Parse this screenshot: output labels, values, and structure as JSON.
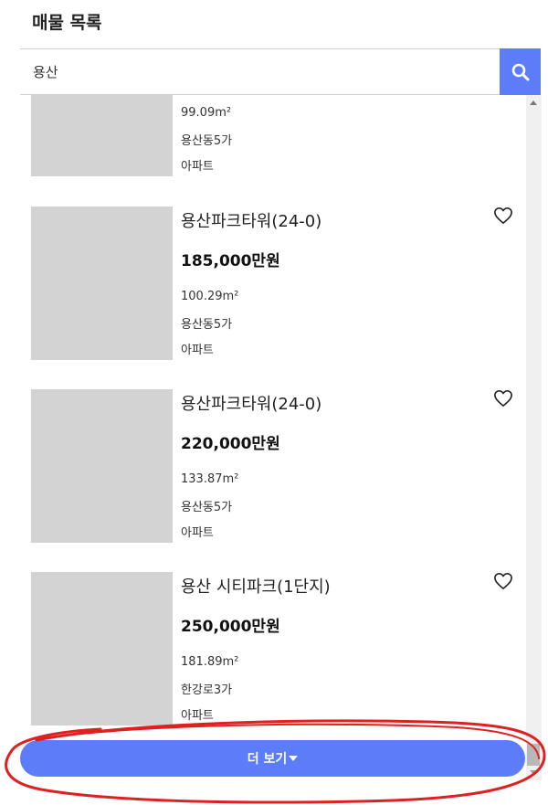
{
  "header": {
    "title": "매물 목록"
  },
  "search": {
    "value": "용산",
    "button_icon": "search-icon"
  },
  "partial_item": {
    "area": "99.09m²",
    "address": "용산동5가",
    "type": "아파트"
  },
  "listings": [
    {
      "name": "용산파크타워(24-0)",
      "price": "185,000만원",
      "area": "100.29m²",
      "address": "용산동5가",
      "type": "아파트"
    },
    {
      "name": "용산파크타워(24-0)",
      "price": "220,000만원",
      "area": "133.87m²",
      "address": "용산동5가",
      "type": "아파트"
    },
    {
      "name": "용산 시티파크(1단지)",
      "price": "250,000만원",
      "area": "181.89m²",
      "address": "한강로3가",
      "type": "아파트"
    }
  ],
  "more_button": {
    "label": "더 보기"
  },
  "colors": {
    "accent": "#5c7cfa",
    "thumbnail": "#d3d3d3",
    "annotation": "#e02020"
  }
}
